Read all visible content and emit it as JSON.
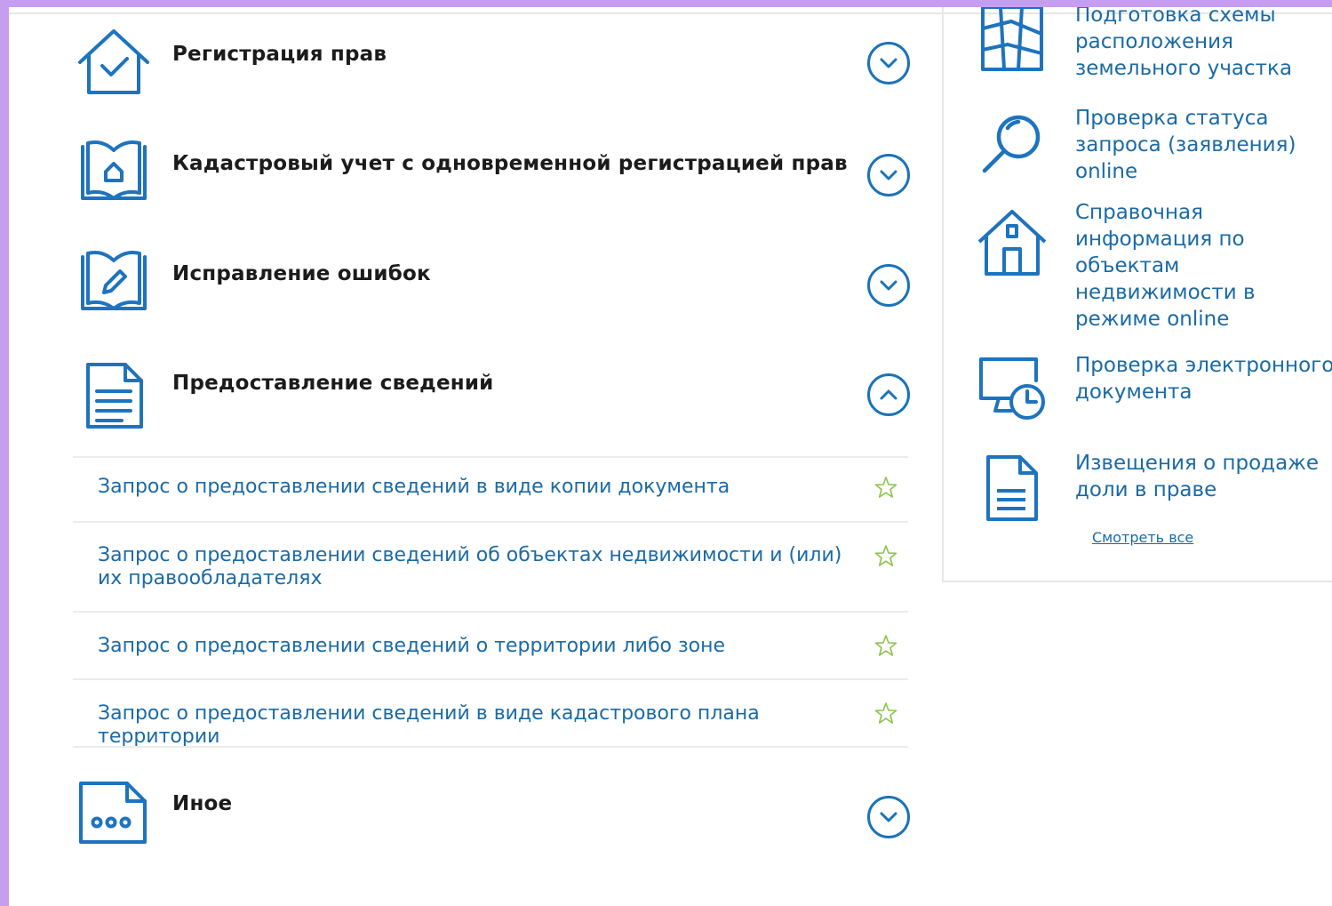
{
  "colors": {
    "accent": "#1e73be",
    "link": "#1a6aa6",
    "star": "#8bc34a",
    "frame": "#c79df2"
  },
  "categories": [
    {
      "title": "Регистрация прав",
      "icon": "house-check-icon",
      "expanded": false
    },
    {
      "title": "Кадастровый учет с одновременной регистрацией прав",
      "icon": "book-house-icon",
      "expanded": false
    },
    {
      "title": "Исправление ошибок",
      "icon": "book-pencil-icon",
      "expanded": false
    },
    {
      "title": "Предоставление сведений",
      "icon": "document-lines-icon",
      "expanded": true
    },
    {
      "title": "Иное",
      "icon": "document-dots-icon",
      "expanded": false
    }
  ],
  "sub_items": [
    "Запрос о предоставлении сведений в виде копии документа",
    "Запрос о предоставлении сведений об объектах недвижимости и (или) их правообладателях",
    "Запрос о предоставлении сведений о территории либо зоне",
    "Запрос о предоставлении сведений в виде кадастрового плана территории"
  ],
  "right_panel": {
    "items": [
      {
        "label": "Подготовка схемы расположения земельного участка",
        "icon": "map-grid-icon"
      },
      {
        "label": "Проверка статуса запроса (заявления) online",
        "icon": "magnifier-icon"
      },
      {
        "label": "Справочная информация по объектам недвижимости в режиме online",
        "icon": "house-icon"
      },
      {
        "label": "Проверка электронного документа",
        "icon": "monitor-clock-icon"
      },
      {
        "label": "Извещения о продаже доли в праве",
        "icon": "document-icon"
      }
    ],
    "see_all": "Смотреть все"
  }
}
